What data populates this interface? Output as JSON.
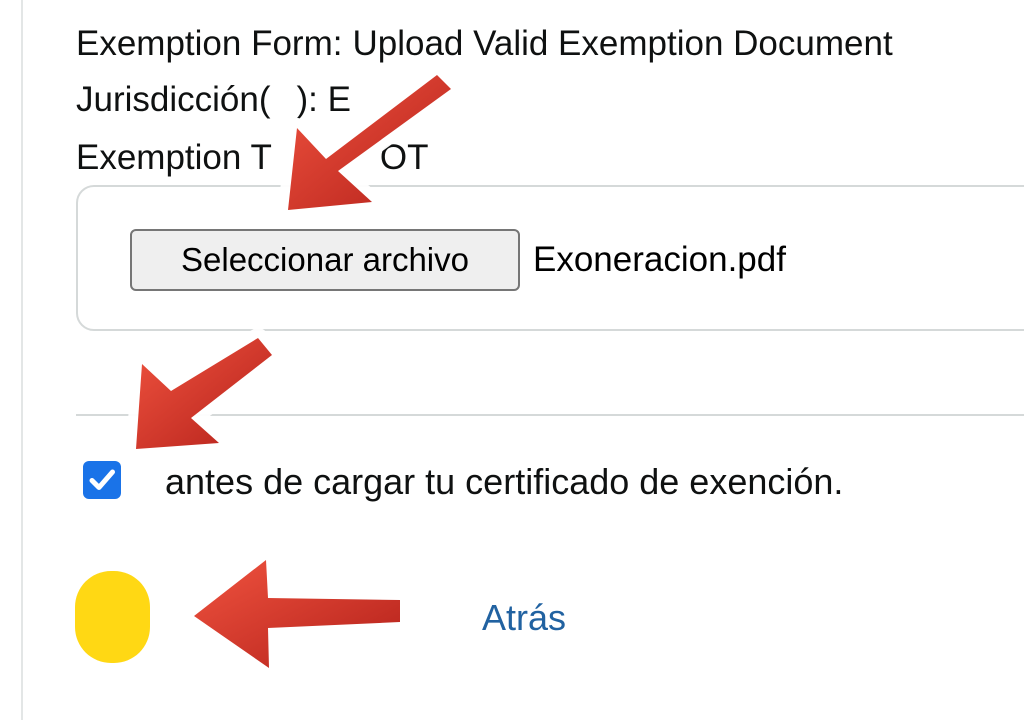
{
  "exemption": {
    "form_label": "Exemption Form:",
    "form_value": "Upload Valid Exemption Document",
    "jurisdiction_label": "Jurisdicción(",
    "jurisdiction_value": "): E",
    "type_label": "Exemption T",
    "type_value": "OT"
  },
  "upload": {
    "choose_file_label": "Seleccionar archivo",
    "file_name": "Exoneracion.pdf"
  },
  "agreement": {
    "checked": true,
    "label": "antes de cargar tu certificado de exención."
  },
  "actions": {
    "back_label": "Atrás"
  },
  "colors": {
    "submit_button": "#ffd814",
    "link": "#2162a1",
    "checkbox": "#1a73e8",
    "annotation_arrow": "#e1392b"
  },
  "icons": {
    "checkbox_mark": "check-icon",
    "annotation": "red-arrow-icon"
  }
}
